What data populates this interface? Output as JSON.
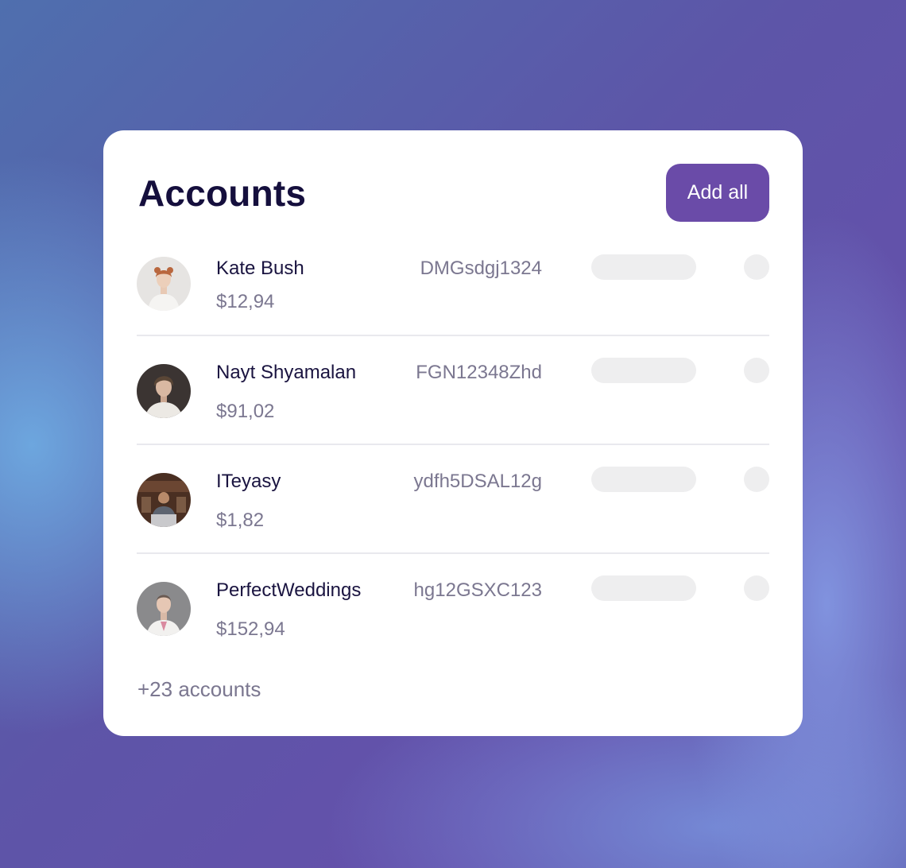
{
  "card": {
    "title": "Accounts",
    "add_all_label": "Add all",
    "more_label": "+23 accounts"
  },
  "accounts": [
    {
      "name": "Kate Bush",
      "amount": "$12,94",
      "code": "DMGsdgj1324",
      "avatar": "portrait-woman-white-shirt"
    },
    {
      "name": "Nayt Shyamalan",
      "amount": "$91,02",
      "code": "FGN12348Zhd",
      "avatar": "portrait-young-man"
    },
    {
      "name": "ITeyasy",
      "amount": "$1,82",
      "code": "ydfh5DSAL12g",
      "avatar": "portrait-man-laptop"
    },
    {
      "name": "PerfectWeddings",
      "amount": "$152,94",
      "code": "hg12GSXC123",
      "avatar": "portrait-woman-grey-bg"
    }
  ],
  "colors": {
    "accent": "#6a4ba8",
    "title": "#150f3d",
    "muted": "#7b7790",
    "placeholder": "#eeeeef"
  }
}
